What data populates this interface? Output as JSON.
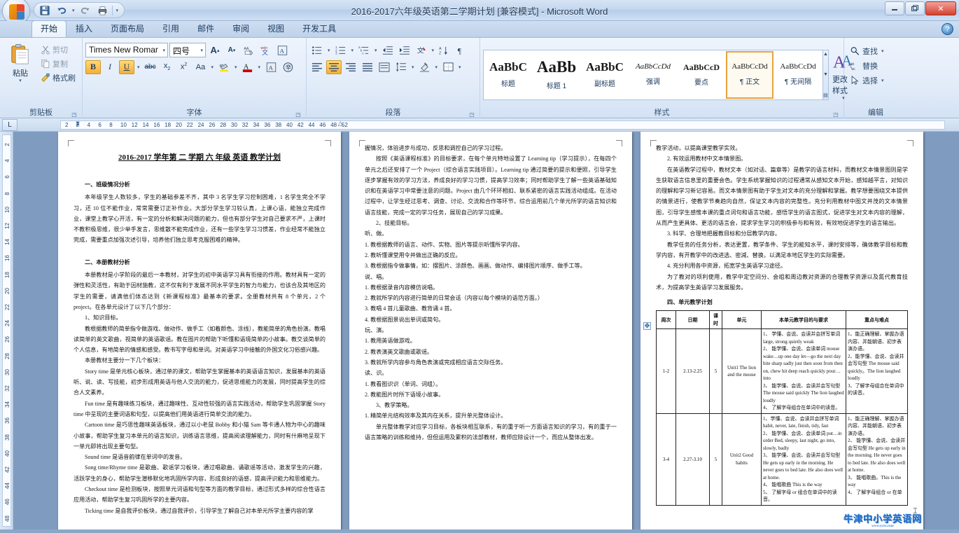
{
  "window": {
    "title": "2016-2017六年级英语第二学期计划 [兼容模式] - Microsoft Word",
    "minimize_label": "–",
    "restore_label": "❐",
    "close_label": "✕",
    "help_label": "?"
  },
  "quick_access": {
    "save": "save-icon",
    "undo": "undo-icon",
    "redo": "redo-icon",
    "print": "print-preview-icon",
    "customize": "customize-qat-icon"
  },
  "tabs": [
    {
      "label": "开始",
      "active": true
    },
    {
      "label": "插入",
      "active": false
    },
    {
      "label": "页面布局",
      "active": false
    },
    {
      "label": "引用",
      "active": false
    },
    {
      "label": "邮件",
      "active": false
    },
    {
      "label": "审阅",
      "active": false
    },
    {
      "label": "视图",
      "active": false
    },
    {
      "label": "开发工具",
      "active": false
    }
  ],
  "ribbon": {
    "clipboard": {
      "group_label": "剪贴板",
      "paste": "粘贴",
      "cut": "剪切",
      "copy": "复制",
      "format_painter": "格式刷"
    },
    "font": {
      "group_label": "字体",
      "font_name": "Times New Romar",
      "font_size": "四号",
      "grow_font": "A↑",
      "shrink_font": "A↓",
      "phonetic_guide": "拼音指南",
      "char_border": "带圈字符",
      "clear_format": "清除格式",
      "bold": "B",
      "italic": "I",
      "underline": "U",
      "strike": "abc",
      "subscript": "x₂",
      "superscript": "x²",
      "change_case": "Aa",
      "highlight": "突出显示",
      "font_color": "A",
      "shading": "字符底纹",
      "enclose": "带圈字符"
    },
    "paragraph": {
      "group_label": "段落",
      "bullets": "项目符号",
      "numbering": "编号",
      "multilevel": "多级列表",
      "decrease_indent": "减少缩进",
      "increase_indent": "增加缩进",
      "asian_layout": "中文版式",
      "sort": "排序",
      "show_marks": "显示编辑标记",
      "align_left": "左对齐",
      "align_center": "居中",
      "align_right": "右对齐",
      "justify": "两端对齐",
      "distribute": "分散对齐",
      "line_spacing": "行距",
      "shading": "底纹",
      "borders": "边框"
    },
    "styles": {
      "group_label": "样式",
      "change_styles": "更改样式",
      "items": [
        {
          "preview": "AaBbC",
          "name": "标题",
          "size": "17px",
          "weight": "bold",
          "italic": "normal"
        },
        {
          "preview": "AaBb",
          "name": "标题 1",
          "size": "22px",
          "weight": "bold",
          "italic": "normal"
        },
        {
          "preview": "AaBbC",
          "name": "副标题",
          "size": "17px",
          "weight": "bold",
          "italic": "normal"
        },
        {
          "preview": "AaBbCcDd",
          "name": "强调",
          "size": "11px",
          "weight": "normal",
          "italic": "italic"
        },
        {
          "preview": "AaBbCcD",
          "name": "要点",
          "size": "12px",
          "weight": "bold",
          "italic": "normal"
        },
        {
          "preview": "AaBbCcDd",
          "name": "正文",
          "size": "11px",
          "weight": "normal",
          "italic": "normal"
        },
        {
          "preview": "AaBbCcDd",
          "name": "无间隔",
          "size": "11px",
          "weight": "normal",
          "italic": "normal"
        }
      ],
      "selected_index": 5
    },
    "editing": {
      "group_label": "编辑",
      "find": "查找",
      "replace": "替换",
      "select": "选择"
    }
  },
  "ruler": {
    "tab_stop_label": "L",
    "h_numbers": [
      "2",
      "2",
      "4",
      "6",
      "8",
      "10",
      "12",
      "14",
      "16",
      "18",
      "20",
      "22",
      "24",
      "26",
      "28",
      "30",
      "32",
      "34",
      "36",
      "38",
      "40",
      "42",
      "44",
      "46",
      "48",
      "52"
    ],
    "v_numbers": [
      "2",
      "4",
      "6",
      "8",
      "10",
      "12",
      "14",
      "16",
      "18",
      "20",
      "22",
      "24",
      "26",
      "28",
      "30",
      "32",
      "34",
      "36",
      "38",
      "40",
      "42",
      "44",
      "46",
      "48"
    ]
  },
  "document": {
    "title": "2016-2017 学年第 二 学期 六 年级 英语 教学计划",
    "page1": {
      "heading1": "一、班级情况分析",
      "para1": "本年级学生人数较多，学生的基础参差不齐，其中 3 名学生学习控制困难，1 名学生完全不学习，还 10 位不能作业，常常需要订正补作业。大部分学生学习较认真，上课心语，能独立完成作业，课堂上教学心开活，有一定的分析和解决问题的能力，但也有部分学生对自己要求不严，上课时不教积极思维，很少举手发言，思维散不能完成作业，还有一些学生学习习惯差，作业经常不能独立完成，需要重点加强次述引导，培养他们独立思考克服困难的精神。",
      "heading2": "二、本册教材分析",
      "para2": "本册教材是小学阶段的最后一本教材，对学生的初中英语学习具有衔接的作用。教材具有一定的弹性和灵活性，有助于因材施教，这不仅有利于发展不同水平学生的智力与能力，也该合及其地区的学生的需要，请满他们体态达到《新课程标准》最基本的要求。全册教材共有 8 个单元，2 个 project。在各单元设计了以下几个部分：",
      "sub1": "1、知识目标。",
      "para3": "教根据教师的简单指令做游戏、做动作、做手工（如着颜色、涂线），教能简单的角色扮演。教唱读简单的英文歌曲，视简单的英语歌谣。教在图片的帮助下听懂和语境简单的小故事。教交谈简单的个人信息，有地简单的情感和感受。教书写字母和单词。对英语学习中接触的外国文化习俗感兴趣。",
      "para4": "本册教材主要分一下几个板块：",
      "para5": "Story time 是单元核心板块，通过单的课文，帮助学生掌握基本的英语语言知识，发展基本的英语听、说、读、写技能，初步形成用英语与他人交流的能力，促进思维能力的发展，同时提高学生的综合人文素养。",
      "para6": "Fun time 是有趣味练习板块，通过趣味性、互动性较强的语言实践活动，帮助学生巩固掌握 Story time 中呈现的主要词语和句型，以提高他们用英语进行简单交流的能力。",
      "para7": "Cartoon time 是巧思性趣味英语板块，通过以小老鼠 Bobby 和小猫 Sam 等卡通人物为中心的趣味小故事，帮助学生复习本单元的语言知识，训练语言思维，提高阅读理解能力，同时有什麻地呈现下一单元即将出现主要句型。",
      "para8": "Sound time 是语音韵律在单词中的发音。",
      "para9": "Song time/Rhyme time 是歌曲、歌谣学习板块，通过唱歌曲、诵歌谣等活动，激发学生的兴趣，活跃学生的身心，帮助学生潜移默化地巩固所学内容，形成良好的语感，提高评识能力和思维能力。",
      "para10": "Checkout time 是检测板块，按照单元词语和句型等方面的教学目标，通过形式多样的综合性语言应用活动，帮助学生复习巩固所学的主要内容。",
      "para11": "Ticking time 是自我评价板块，通过自我评价，引导学生了解自己对本单元所学主要内容的掌"
    },
    "page2": {
      "para1": "握情况，体验进步与成功，反思和调控自己的学习过程。",
      "para2": "按照《英语课程标准》的目标要求，在每个单元特地设置了 Learning tip（学习提示），在每四个单元之后还安排了一个 Project（综合语言实践项目）。Learning tip 通过简要的提示和便照，引导学生逐步掌握有效的学习方法，养成良好的学习习惯，提高学习效率；同时帮助学生了解一些英语基础知识和在英语学习中常要注意的问题。Project 由几个环环相扣、联系紧密的语言实践活动组成。在活动过程中，让学生经过思考、调查、讨论、交流和合作等环节，综合运用前几个单元所学的语言知识和语言技能，完成一定的学习任务，展现自己的学习成果。",
      "sub2": "2、技能目标。",
      "grp1": "听、做。",
      "l1": "1. 教根据教师的语言、动作、实物、图片等提示听懂所学内容。",
      "l2": "2. 教听懂课堂用令并做出正确的反应。",
      "l3": "3. 教根据指令做事情，如：摆图片、涂颜色、画画、做动作、编排图片顺序、做手工等。",
      "grp2": "说、唱。",
      "l4": "1. 教根据录音内容模仿说唱。",
      "l5": "2. 教就所学的内容进行简单的日常会话（内容以每个模块的语范方面。）",
      "l6": "3. 教唱 4 首儿童歌曲、教背诵 4 首。",
      "l7": "4. 教根据图景说出单词或简句。",
      "grp3": "玩、演。",
      "l8": "1. 教用英语做游戏。",
      "l9": "2. 教表演英文歌曲或歌谣。",
      "l10": "3. 教就所学内容参与角色表演或完成相应语言交际任务。",
      "grp4": "读、识。",
      "l11": "1. 教看图识识（单词、词组）。",
      "l12": "2. 教能图片时所下语境小故事。",
      "sub3": "3、教学策略。",
      "l13": "1. 精简单元结构效率及其内在关系，提升单元整体设计。",
      "para3": "单元整体教学对应学习目标，各板块相互联系，有的重于听一方面语言知识的学习，有的重于一语言策略的训练和维持，但但运用及累积的法部教材，教师应除设计一个，而应从整体出发。"
    },
    "page3": {
      "para1": "教学活动，以提高课堂教学实效。",
      "sub1": "2. 有效运用教材中文本情景图。",
      "para2": "在英语教学过程中，教材文本（如对话、篇章等）是教学的语言材料，而教材文本情景图则是学生获取语言信息里的重要会色。学生系统掌握知识的过程通常从感知文本开始，感知越平言，对知识的理解和学习新记容易。而文本情景图有助于学生对文本的充分理解和掌握。教学想要围绕文本提供的情景进行，使教学节奏趋向自然，保证文本内容的完整性。充分利用教材中图文并茂的文本情景图，引导学生感惟本课的重点词句和语言功能，感悟学生的语言图式，促进学生对文本内容的理解，从而产生更具体、更活的语言会，提求学生学习的积极参与和有效，有效地促进学生的语言输出。",
      "sub2": "3. 科学、合理地把握教目标和分层教学内容。",
      "para3": "教学任务的任务分析，表达更置，教学条件、学生的能知水平，课时安排等，确体教学目标和教学内容，有开教学中的改进选、密減、替换，以满足本地区学生的实际需要。",
      "sub3": "4. 充分利用各中资源，拓宽学生英语学习途径。",
      "para4": "为了教对的项利使用，教学中定空间分、会组和周边教对资源的合理教学资源以及氮代教育技术，为提高学生英语学习发展服务。",
      "section4_heading": "四、单元教学计划",
      "table": {
        "headers": [
          "周次",
          "日期",
          "课时",
          "单元",
          "本单元教学目的与要求",
          "重点与难点"
        ],
        "rows": [
          {
            "week": "1-2",
            "date": "2.13-2.25",
            "periods": "5",
            "unit": "Unit1 The lion and the mouse",
            "objectives": "1、 学懂、会说、会读并会拼写单词 large, strong quietly weak\n2、 能学懂、会说、会读单词 mouse wake…up one day let—go the next day bite sharp sadly just then soon from then on, chew hit deep reach quickly pour…into\n3、 能学懂、会说、会读并会写句型 The mouse said quickly The lion laughed loudly\n4、 了解字母组合在单词中的读音。",
            "points": "1、能正确理解、掌握办语内容、并能朝语、初步表演办语。\n2、能学懂、会说、会读并会写句型 The mouse said quickly。The lion laughed loudly\n3、了解字母组合在单词中的读音。"
          },
          {
            "week": "3-4",
            "date": "2.27-3.10",
            "periods": "5",
            "unit": "Unit2 Good habits",
            "objectives": "1、学懂、会说、会读并会拼写单词 habit, never, late, finish, tidy, fast\n2、 能学懂、会说、会读单词 put…in order Bed, sleepy, last night, go into, slowly, badly\n3、 能学懂、会说、会读并会写句型 He gets up early in the morning. He never goes to bed late. He also does well at home.\n4、 能唱歌曲 This is the way\n5、 了解字母 or 组合在单词中的读音。",
            "points": "1、能正确理解、掌握办语内容、并能朝语、初步表演办语。\n2、 能学懂、会说、会读并会写句型 He gets up early in the morning. He never goes to bed late. He also does well at home.\n3、 能唱歌曲。This is the way\n4、 了解字母组合 or 在单"
          }
        ]
      }
    }
  },
  "watermark": {
    "text": "牛津中小学英语网",
    "subtext": "www.yyzx.com",
    "color": "#1668c8"
  }
}
